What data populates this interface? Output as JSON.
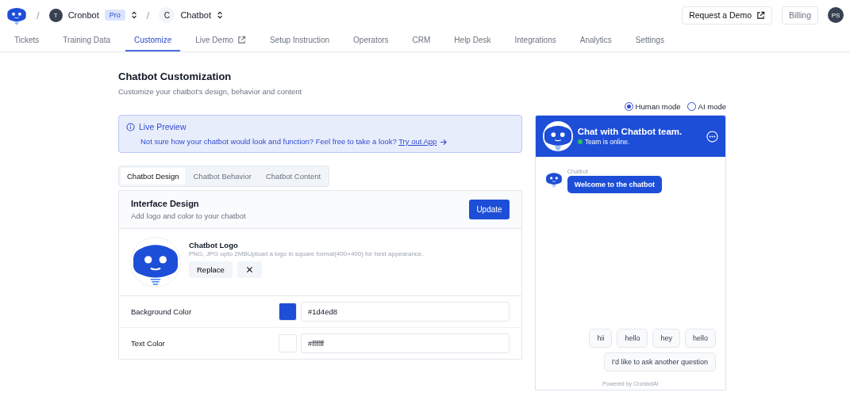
{
  "topbar": {
    "separators": [
      "/",
      "/"
    ],
    "org": {
      "initial": "T",
      "name": "Cronbot",
      "badge": "Pro"
    },
    "project": {
      "initial": "C",
      "name": "Chatbot"
    },
    "request_demo": "Request a Demo",
    "billing": "Billing",
    "avatar": "PS"
  },
  "nav_tabs": [
    {
      "label": "Tickets",
      "selected": false,
      "external": false
    },
    {
      "label": "Training Data",
      "selected": false,
      "external": false
    },
    {
      "label": "Customize",
      "selected": true,
      "external": false
    },
    {
      "label": "Live Demo",
      "selected": false,
      "external": true
    },
    {
      "label": "Setup Instruction",
      "selected": false,
      "external": false
    },
    {
      "label": "Operators",
      "selected": false,
      "external": false
    },
    {
      "label": "CRM",
      "selected": false,
      "external": false
    },
    {
      "label": "Help Desk",
      "selected": false,
      "external": false
    },
    {
      "label": "Integrations",
      "selected": false,
      "external": false
    },
    {
      "label": "Analytics",
      "selected": false,
      "external": false
    },
    {
      "label": "Settings",
      "selected": false,
      "external": false
    }
  ],
  "page": {
    "title": "Chatbot Customization",
    "subtitle": "Customize your chatbot’s design, behavior and content"
  },
  "modes": [
    {
      "label": "Human mode",
      "selected": true
    },
    {
      "label": "AI mode",
      "selected": false
    }
  ],
  "live_preview": {
    "title": "Live Preview",
    "text": "Not sure how your chatbot would look and function? Feel free to take a look?",
    "link": "Try out App"
  },
  "section_tabs": [
    {
      "label": "Chatbot Design",
      "selected": true
    },
    {
      "label": "Chatbot Behavior",
      "selected": false
    },
    {
      "label": "Chatbot Content",
      "selected": false
    }
  ],
  "interface_design": {
    "title": "Interface Design",
    "subtitle": "Add logo and color to your chatbot",
    "update_button": "Update",
    "logo": {
      "title": "Chatbot Logo",
      "hint": "PNG, JPG upto 2MBUpload a logo in square format(400×400) for best appearance.",
      "replace_button": "Replace"
    },
    "colors": [
      {
        "label": "Background Color",
        "value": "#1d4ed8",
        "color": "#1d4ed8"
      },
      {
        "label": "Text Color",
        "value": "#ffffff",
        "color": "#ffffff"
      }
    ]
  },
  "chat": {
    "title": "Chat with Chatbot team.",
    "status": "Team is online.",
    "online": true,
    "messages": [
      {
        "sender": "Chatbot",
        "text": "Welcome to the chatbot"
      }
    ],
    "suggestions": [
      "hii",
      "hello",
      "hey",
      "hello",
      "I'd like to ask another question"
    ],
    "footer": "Powered by CronbotAI"
  }
}
